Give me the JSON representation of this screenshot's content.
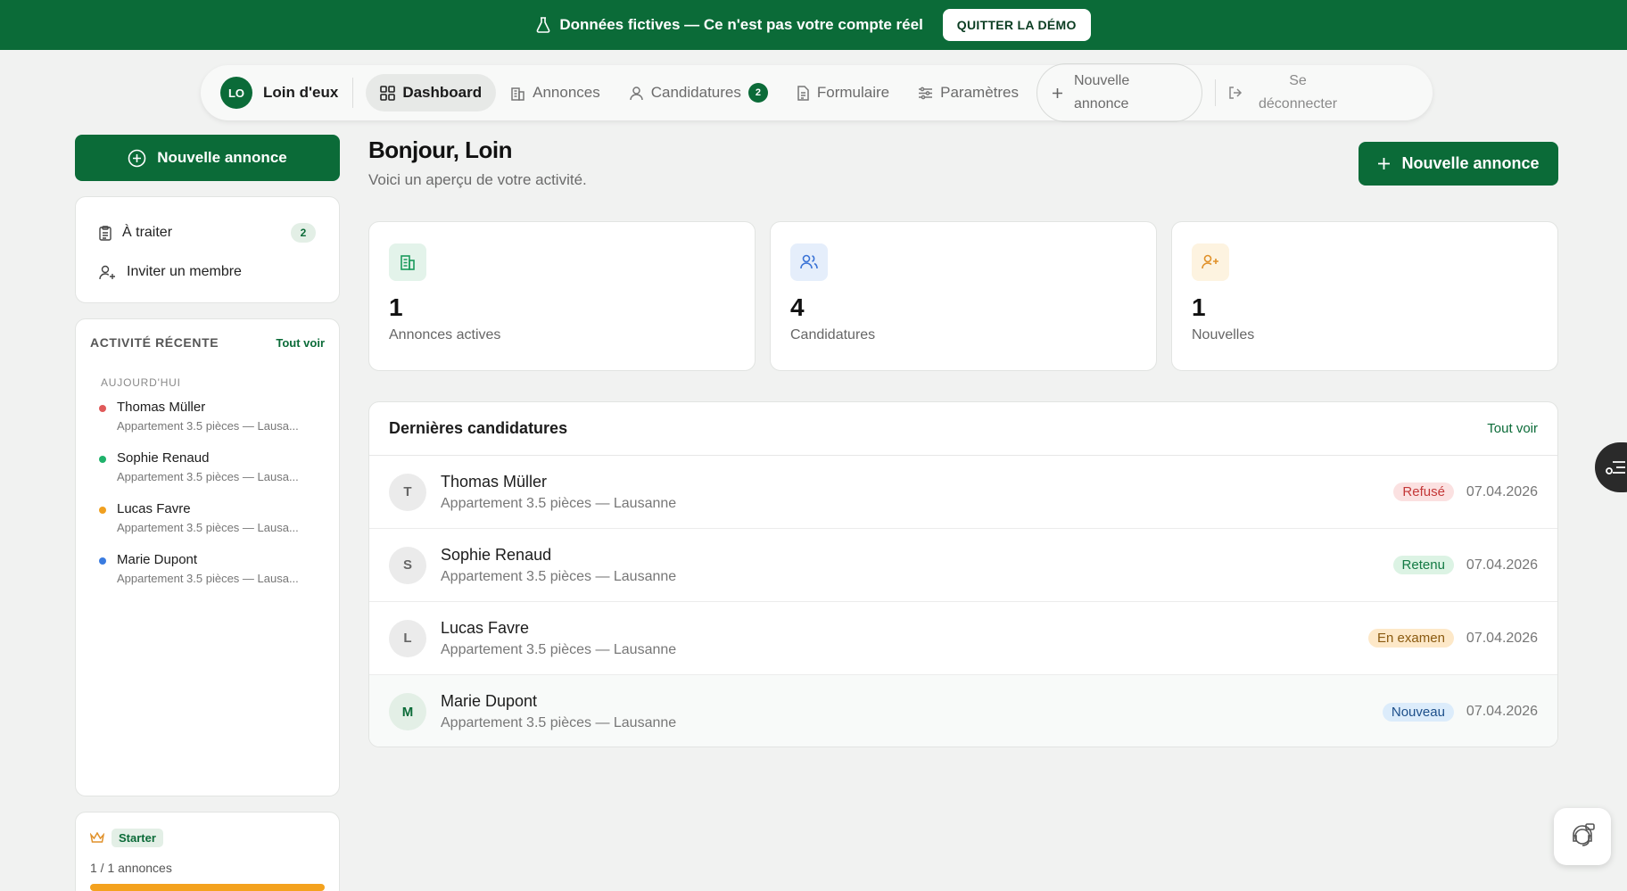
{
  "banner": {
    "text": "Données fictives — Ce n'est pas votre compte réel",
    "quit_label": "QUITTER LA DÉMO",
    "icon": "flask-icon"
  },
  "nav": {
    "brand_initials": "LO",
    "brand_name": "Loin d'eux",
    "items": [
      {
        "label": "Dashboard",
        "icon": "grid-icon",
        "active": true
      },
      {
        "label": "Annonces",
        "icon": "building-icon"
      },
      {
        "label": "Candidatures",
        "icon": "user-icon",
        "badge": "2"
      },
      {
        "label": "Formulaire",
        "icon": "document-icon"
      },
      {
        "label": "Paramètres",
        "icon": "sliders-icon"
      }
    ],
    "new_line1": "Nouvelle",
    "new_line2": "annonce",
    "logout_line1": "Se",
    "logout_line2": "déconnecter"
  },
  "sidebar": {
    "new_label": "Nouvelle annonce",
    "quick": [
      {
        "label": "À traiter",
        "badge": "2",
        "icon": "clipboard-icon"
      },
      {
        "label": "Inviter un membre",
        "icon": "user-plus-icon"
      }
    ],
    "activity": {
      "title": "ACTIVITÉ RÉCENTE",
      "see_all": "Tout voir",
      "day": "AUJOURD'HUI",
      "items": [
        {
          "name": "Thomas Müller",
          "sub": "Appartement 3.5 pièces — Lausa...",
          "color": "#e05a5a"
        },
        {
          "name": "Sophie Renaud",
          "sub": "Appartement 3.5 pièces — Lausa...",
          "color": "#1fb26b"
        },
        {
          "name": "Lucas Favre",
          "sub": "Appartement 3.5 pièces — Lausa...",
          "color": "#f0a020"
        },
        {
          "name": "Marie Dupont",
          "sub": "Appartement 3.5 pièces — Lausa...",
          "color": "#3a7be0"
        }
      ]
    },
    "plan": {
      "name": "Starter",
      "usage": "1 / 1 annonces",
      "usage_fraction": 1.0,
      "bar_color": "#f4a21e"
    }
  },
  "main": {
    "greeting": "Bonjour, Loin",
    "subtitle": "Voici un aperçu de votre activité.",
    "new_label": "Nouvelle annonce",
    "stats": [
      {
        "value": "1",
        "label": "Annonces actives",
        "icon": "building-icon",
        "bg": "#e3f3ea",
        "fg": "#1a9a5c"
      },
      {
        "value": "4",
        "label": "Candidatures",
        "icon": "users-icon",
        "bg": "#e5eefb",
        "fg": "#3a73d6"
      },
      {
        "value": "1",
        "label": "Nouvelles",
        "icon": "user-plus-icon",
        "bg": "#fdf3e0",
        "fg": "#e0912a"
      }
    ],
    "candidatures": {
      "title": "Dernières candidatures",
      "see_all": "Tout voir",
      "rows": [
        {
          "initial": "T",
          "name": "Thomas Müller",
          "sub": "Appartement 3.5 pièces — Lausanne",
          "status": "Refusé",
          "status_bg": "#fbe1e1",
          "status_fg": "#c43838",
          "date": "07.04.2026"
        },
        {
          "initial": "S",
          "name": "Sophie Renaud",
          "sub": "Appartement 3.5 pièces — Lausanne",
          "status": "Retenu",
          "status_bg": "#dcf3e4",
          "status_fg": "#137a44",
          "date": "07.04.2026"
        },
        {
          "initial": "L",
          "name": "Lucas Favre",
          "sub": "Appartement 3.5 pièces — Lausanne",
          "status": "En examen",
          "status_bg": "#fde8c8",
          "status_fg": "#8a5a10",
          "date": "07.04.2026"
        },
        {
          "initial": "M",
          "name": "Marie Dupont",
          "sub": "Appartement 3.5 pièces — Lausanne",
          "status": "Nouveau",
          "status_bg": "#dcecfb",
          "status_fg": "#1d4f8a",
          "date": "07.04.2026",
          "highlight": true
        }
      ]
    }
  },
  "floating": {
    "side_icon": "list-lines-icon",
    "help_icon": "support-agent-icon"
  }
}
